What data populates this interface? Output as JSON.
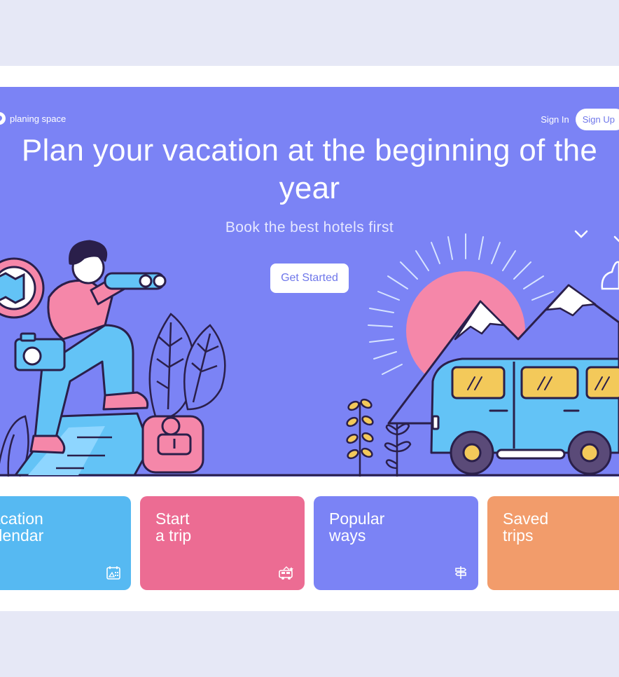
{
  "brand": {
    "name": "planing space"
  },
  "nav": {
    "signin_label": "Sign In",
    "signup_label": "Sign Up"
  },
  "hero": {
    "headline": "Plan your vacation at the beginning of the year",
    "subline": "Book the best hotels first",
    "cta_label": "Get Started"
  },
  "cards": [
    {
      "title": "Vacation\ncalendar",
      "icon": "calendar-icon",
      "color": "#56b9f2"
    },
    {
      "title": "Start\na trip",
      "icon": "bus-icon",
      "color": "#ec6c93"
    },
    {
      "title": "Popular\nways",
      "icon": "signpost-icon",
      "color": "#7b83f5"
    },
    {
      "title": "Saved\ntrips",
      "icon": "bookmark-icon",
      "color": "#f29c6b"
    }
  ],
  "colors": {
    "background": "#e6e8f6",
    "hero": "#7b83f5",
    "sun": "#f587a9",
    "bus": "#63c3f6",
    "outline": "#2a1f4a"
  }
}
